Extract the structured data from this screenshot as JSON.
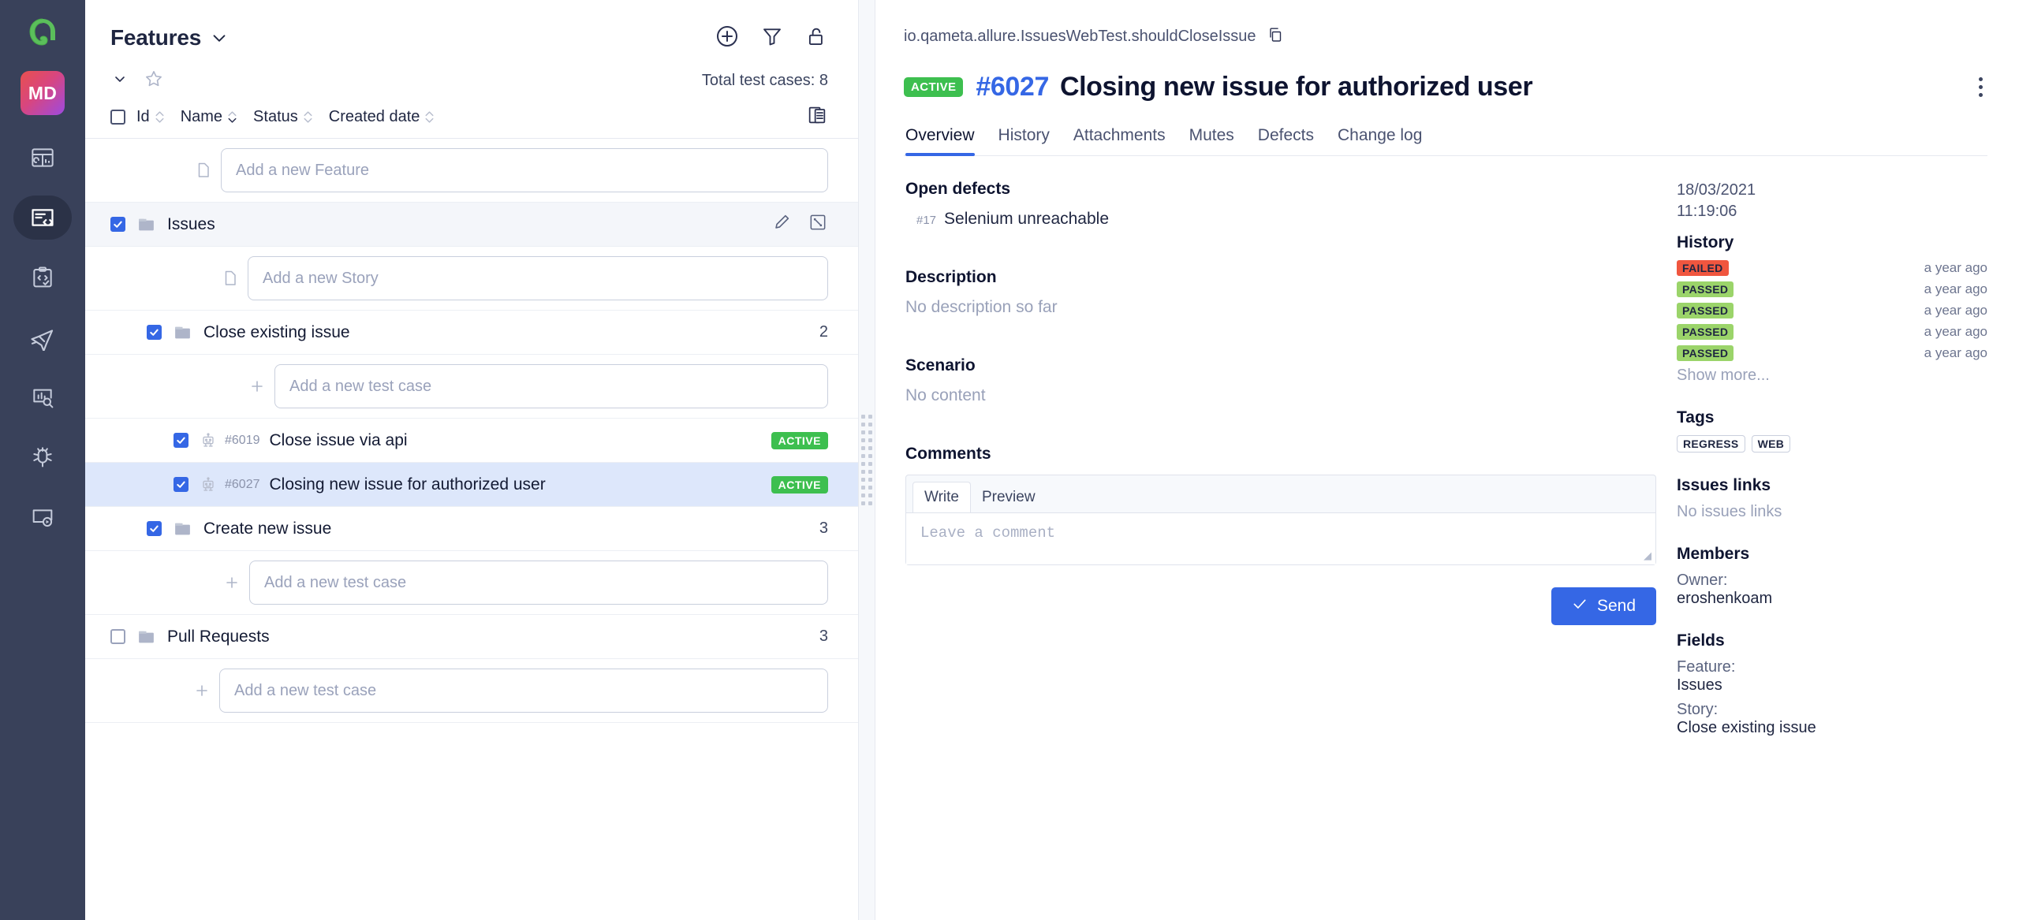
{
  "rail": {
    "logo_icon": "allure-logo-icon",
    "avatar_initials": "MD",
    "items": [
      {
        "icon": "dashboard-icon",
        "name": "nav-dashboards",
        "active": false
      },
      {
        "icon": "test-cases-icon",
        "name": "nav-test-cases",
        "active": true
      },
      {
        "icon": "clipboard-check-icon",
        "name": "nav-test-plans",
        "active": false
      },
      {
        "icon": "rocket-icon",
        "name": "nav-launches",
        "active": false
      },
      {
        "icon": "report-search-icon",
        "name": "nav-analytics",
        "active": false
      },
      {
        "icon": "bug-icon",
        "name": "nav-defects",
        "active": false
      },
      {
        "icon": "screen-play-icon",
        "name": "nav-sessions",
        "active": false
      }
    ]
  },
  "tree": {
    "title": "Features",
    "title_caret_icon": "chevron-down-icon",
    "header_icons": [
      {
        "icon": "plus-circle-icon",
        "name": "add-feature-button"
      },
      {
        "icon": "filter-icon",
        "name": "filter-button"
      },
      {
        "icon": "unlock-icon",
        "name": "lock-toggle-button"
      }
    ],
    "collapse_icon": "chevron-down-icon",
    "favorite_icon": "star-icon",
    "total_label": "Total test cases: 8",
    "columns": [
      {
        "label": "Id",
        "sort": "none"
      },
      {
        "label": "Name",
        "sort": "desc"
      },
      {
        "label": "Status",
        "sort": "none"
      },
      {
        "label": "Created date",
        "sort": "none"
      }
    ],
    "columns_settings_icon": "columns-settings-icon",
    "add_feature_placeholder": "Add a new Feature",
    "rows": [
      {
        "kind": "feature",
        "level": 0,
        "name": "Issues",
        "checked": true,
        "highlight": true,
        "icons": [
          "pencil-icon",
          "expand-icon"
        ]
      },
      {
        "kind": "add",
        "level": 1,
        "lead_icon": "file-icon",
        "placeholder": "Add a new Story"
      },
      {
        "kind": "story",
        "level": 1,
        "name": "Close existing issue",
        "checked": true,
        "count": "2"
      },
      {
        "kind": "add",
        "level": 2,
        "lead_icon": "plus-icon",
        "placeholder": "Add a new test case"
      },
      {
        "kind": "case",
        "level": 2,
        "id": "#6019",
        "name": "Close issue via api",
        "checked": true,
        "status": "ACTIVE"
      },
      {
        "kind": "case",
        "level": 2,
        "id": "#6027",
        "name": "Closing new issue for authorized user",
        "checked": true,
        "status": "ACTIVE",
        "selected": true
      },
      {
        "kind": "story",
        "level": 1,
        "name": "Create new issue",
        "checked": true,
        "count": "3"
      },
      {
        "kind": "add",
        "level": 2,
        "lead_icon": "plus-icon",
        "placeholder": "Add a new test case"
      },
      {
        "kind": "feature",
        "level": 0,
        "name": "Pull Requests",
        "checked": false,
        "count": "3"
      },
      {
        "kind": "add",
        "level": 3,
        "lead_icon": "plus-icon",
        "placeholder": "Add a new test case"
      }
    ]
  },
  "detail": {
    "breadcrumb": "io.qameta.allure.IssuesWebTest.shouldCloseIssue",
    "copy_icon": "copy-icon",
    "status_badge": "ACTIVE",
    "id": "#6027",
    "name": "Closing new issue for authorized user",
    "menu_icon": "kebab-menu-icon",
    "tabs": [
      {
        "label": "Overview",
        "active": true
      },
      {
        "label": "History",
        "active": false
      },
      {
        "label": "Attachments",
        "active": false
      },
      {
        "label": "Mutes",
        "active": false
      },
      {
        "label": "Defects",
        "active": false
      },
      {
        "label": "Change log",
        "active": false
      }
    ],
    "open_defects_heading": "Open defects",
    "open_defects": [
      {
        "id": "#17",
        "text": "Selenium unreachable"
      }
    ],
    "description_heading": "Description",
    "description_text": "No description so far",
    "scenario_heading": "Scenario",
    "scenario_text": "No content",
    "comments_heading": "Comments",
    "comment_tabs": [
      {
        "label": "Write",
        "active": true
      },
      {
        "label": "Preview",
        "active": false
      }
    ],
    "comment_placeholder": "Leave a comment",
    "send_label": "Send",
    "send_icon": "check-icon",
    "send_color": "#3567e5"
  },
  "sidebar": {
    "date": "18/03/2021",
    "time": "11:19:06",
    "history_heading": "History",
    "history": [
      {
        "status": "FAILED",
        "time": "a year ago",
        "color": "#f0563f"
      },
      {
        "status": "PASSED",
        "time": "a year ago",
        "color": "#9bd46a"
      },
      {
        "status": "PASSED",
        "time": "a year ago",
        "color": "#9bd46a"
      },
      {
        "status": "PASSED",
        "time": "a year ago",
        "color": "#9bd46a"
      },
      {
        "status": "PASSED",
        "time": "a year ago",
        "color": "#9bd46a"
      }
    ],
    "show_more": "Show more...",
    "tags_heading": "Tags",
    "tags": [
      "REGRESS",
      "WEB"
    ],
    "issues_links_heading": "Issues links",
    "issues_links_empty": "No issues links",
    "members_heading": "Members",
    "owner_label": "Owner:",
    "owner_value": "eroshenkoam",
    "fields_heading": "Fields",
    "fields": [
      {
        "label": "Feature:",
        "value": "Issues"
      },
      {
        "label": "Story:",
        "value": "Close existing issue"
      }
    ]
  }
}
